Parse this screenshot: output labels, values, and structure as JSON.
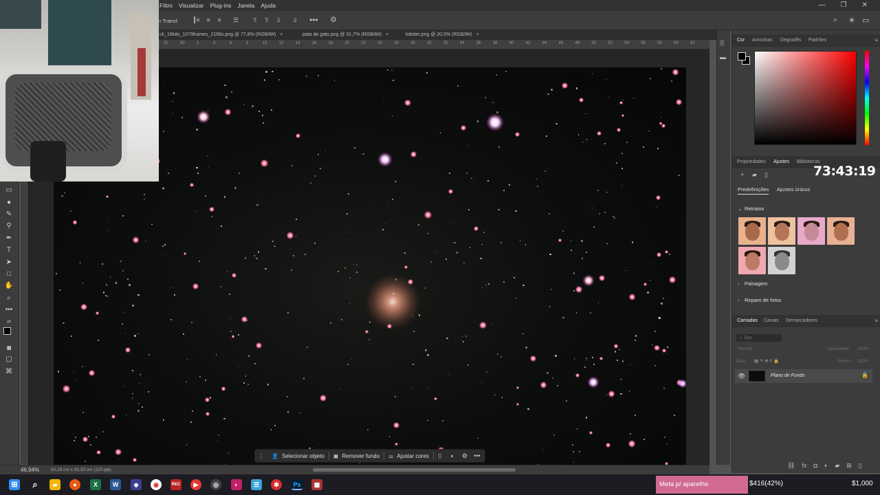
{
  "menu": [
    "Filtro",
    "Visualizar",
    "Plug-ins",
    "Janela",
    "Ajuda"
  ],
  "window_controls": [
    "—",
    "❐",
    "✕"
  ],
  "options_bar": {
    "label": "r Transf."
  },
  "tabs": [
    {
      "title": "ck_16bits_1079frames_2166s.png @ 77,8% (RGB/8#)",
      "close": "×"
    },
    {
      "title": "pata de gato.png @ 31,7% (RGB/8#)",
      "close": "×"
    },
    {
      "title": "lobster.png @ 20,5% (RGB/8#)",
      "close": "×"
    }
  ],
  "ruler_ticks": [
    "31",
    "30",
    "2",
    "4",
    "6",
    "8",
    "10",
    "12",
    "14",
    "16",
    "18",
    "20",
    "22",
    "24",
    "26",
    "28",
    "30",
    "32",
    "34",
    "36",
    "38",
    "40",
    "42",
    "44",
    "46",
    "48",
    "50",
    "52",
    "54",
    "56",
    "58",
    "60",
    "62"
  ],
  "status": {
    "zoom": "46,94%",
    "doc_size": "62,19 cm x 42,33 cm (120 ppi)"
  },
  "context_bar": {
    "select_subject": "Selecionar objeto",
    "remove_background": "Remover fundo",
    "adjust_colors": "Ajustar cores"
  },
  "color_panel": {
    "tabs": [
      "Cor",
      "Amostras",
      "Degradês",
      "Padrões"
    ],
    "hue_color": "#ff0000",
    "foreground": "#000000",
    "background": "#000000"
  },
  "adjustments_panel": {
    "tabs": [
      "Propriedades",
      "Ajustes",
      "Bibliotecas"
    ],
    "timer": "73:43:19",
    "subtabs": [
      "Predefinições",
      "Ajustes únicos"
    ],
    "sections": [
      "Retratos",
      "Paisagem",
      "Reparo de fotos"
    ]
  },
  "layers_panel": {
    "tabs": [
      "Camadas",
      "Canais",
      "Demarcadores"
    ],
    "search_placeholder": "Tipo",
    "blend_mode": "Normal",
    "opacity_label": "Opacidade:",
    "opacity_value": "100%",
    "lock_label": "Bloq.:",
    "fill_label": "Preen.:",
    "fill_value": "100%",
    "layer_name": "Plano de Fundo"
  },
  "stream_overlay": {
    "goal_label": "Meta p/ aparelho",
    "goal_progress": "$416(42%)",
    "goal_target": "$1,000"
  }
}
